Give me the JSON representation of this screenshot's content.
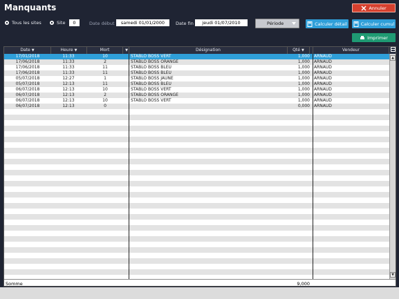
{
  "window": {
    "title": "Manquants"
  },
  "toolbar": {
    "annuler_label": "Annuler",
    "tous_sites_label": "Tous les sites",
    "site_label": "Site",
    "site_value": "0",
    "date_debut_label": "Date début",
    "date_debut_value": "samedi 01/01/2000",
    "date_fin_label": "Date fin",
    "date_fin_value": "jeudi 01/07/2010",
    "periode_label": "Période",
    "calculer_detail_label": "Calculer détail",
    "calculer_cumul_label": "Calculer cumul",
    "imprimer_label": "Imprimer"
  },
  "grid": {
    "columns": [
      "Date",
      "Heure",
      "Mort",
      "",
      "Désignation",
      "Qté",
      "",
      "Vendeur"
    ],
    "rows": [
      {
        "date": "17/01/2018",
        "heure": "11:33",
        "mort": "10",
        "designation": "STABLO BOSS VERT",
        "qte": "1,000",
        "vendeur": "ARNAUD"
      },
      {
        "date": "17/06/2018",
        "heure": "11:33",
        "mort": "2",
        "designation": "STABLO BOSS ORANGE",
        "qte": "1,000",
        "vendeur": "ARNAUD"
      },
      {
        "date": "17/06/2018",
        "heure": "11:33",
        "mort": "11",
        "designation": "STABLO BOSS BLEU",
        "qte": "1,000",
        "vendeur": "ARNAUD"
      },
      {
        "date": "17/06/2018",
        "heure": "11:33",
        "mort": "11",
        "designation": "STABLO BOSS BLEU",
        "qte": "1,000",
        "vendeur": "ARNAUD"
      },
      {
        "date": "05/07/2018",
        "heure": "12:27",
        "mort": "1",
        "designation": "STABLO BOSS JAUNE",
        "qte": "1,000",
        "vendeur": "ARNAUD"
      },
      {
        "date": "05/07/2018",
        "heure": "12:13",
        "mort": "11",
        "designation": "STABLO BOSS BLEU",
        "qte": "1,000",
        "vendeur": "ARNAUD"
      },
      {
        "date": "06/07/2018",
        "heure": "12:13",
        "mort": "10",
        "designation": "STABLO BOSS VERT",
        "qte": "1,000",
        "vendeur": "ARNAUD"
      },
      {
        "date": "06/07/2018",
        "heure": "12:13",
        "mort": "2",
        "designation": "STABLO BOSS ORANGE",
        "qte": "1,000",
        "vendeur": "ARNAUD"
      },
      {
        "date": "06/07/2018",
        "heure": "12:13",
        "mort": "10",
        "designation": "STABLO BOSS VERT",
        "qte": "1,000",
        "vendeur": "ARNAUD"
      },
      {
        "date": "06/07/2018",
        "heure": "12:13",
        "mort": "0",
        "designation": "",
        "qte": "0,000",
        "vendeur": "ARNAUD"
      }
    ],
    "selected_row": 0
  },
  "footer": {
    "somme_label": "Somme",
    "somme_value": "9,000"
  },
  "colors": {
    "accent": "#2f9fd9",
    "danger": "#d6402e",
    "print": "#1f9a73",
    "header_bg": "#1f2433"
  },
  "icons": {
    "annuler": "x-icon",
    "settings": "gear-icon",
    "detail": "calculator-icon",
    "cumul": "calculator-icon",
    "imprimer": "printer-icon",
    "periode": "chevron-down-icon"
  }
}
